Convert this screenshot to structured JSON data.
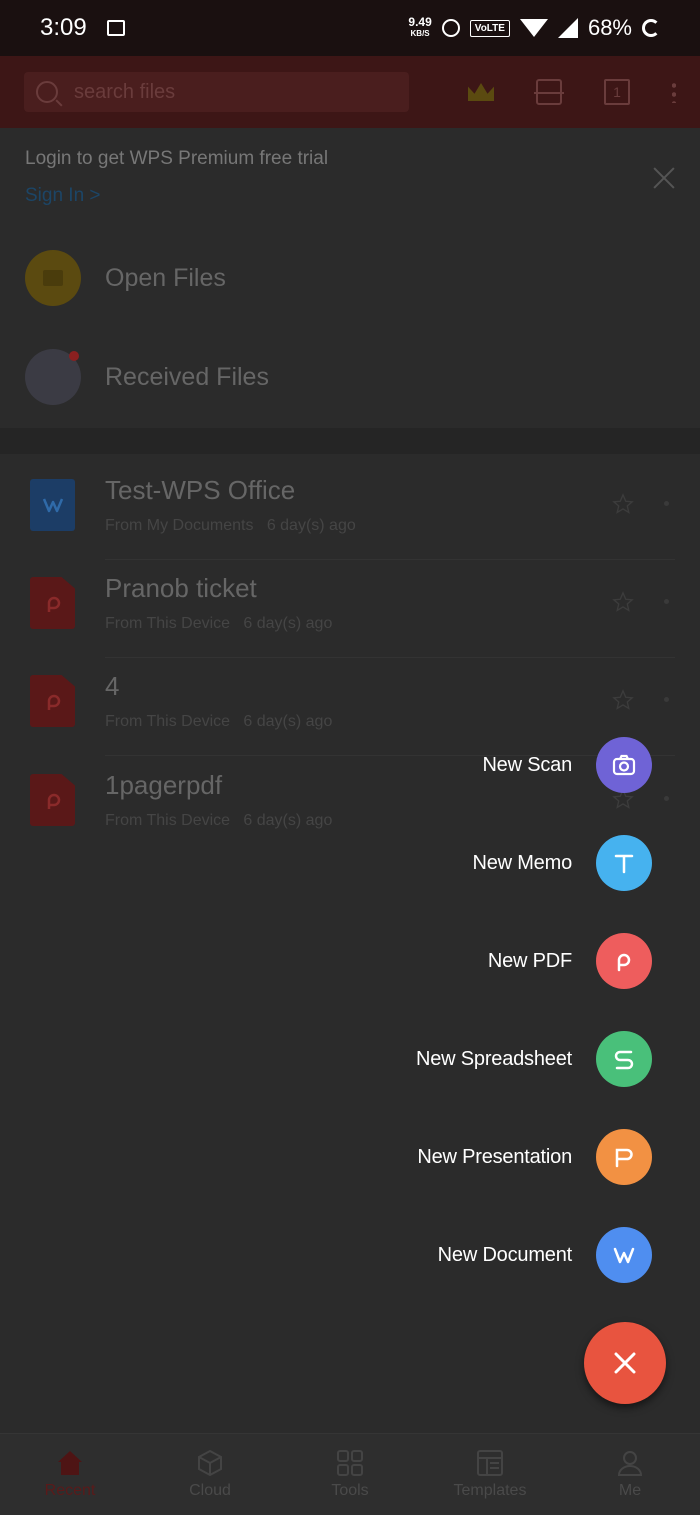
{
  "status_bar": {
    "time": "3:09",
    "net_speed": "9.49",
    "net_unit": "KB/S",
    "volte": "VoLTE",
    "battery": "68%"
  },
  "app_bar": {
    "search_placeholder": "search files",
    "icons": [
      "search-icon",
      "crown-icon",
      "scan-icon",
      "window-count-icon",
      "more-vert-icon"
    ],
    "window_count": "1"
  },
  "banner": {
    "message": "Login to get WPS Premium free trial",
    "sign_in": "Sign In >"
  },
  "quick_access": [
    {
      "label": "Open Files",
      "icon": "folder-icon"
    },
    {
      "label": "Received Files",
      "icon": "received-icon"
    }
  ],
  "recent_files": [
    {
      "name": "Test-WPS Office",
      "source": "From My Documents",
      "age": "6 day(s) ago",
      "type": "writer"
    },
    {
      "name": "Pranob ticket",
      "source": "From This Device",
      "age": "6 day(s) ago",
      "type": "pdf"
    },
    {
      "name": "4",
      "source": "From This Device",
      "age": "6 day(s) ago",
      "type": "pdf"
    },
    {
      "name": "1pagerpdf",
      "source": "From This Device",
      "age": "6 day(s) ago",
      "type": "pdf"
    }
  ],
  "fab_menu": [
    {
      "label": "New Scan",
      "color": "#6f63d6",
      "icon": "camera-icon"
    },
    {
      "label": "New Memo",
      "color": "#46b2ef",
      "icon": "memo-icon"
    },
    {
      "label": "New PDF",
      "color": "#ee5d5d",
      "icon": "pdf-icon"
    },
    {
      "label": "New Spreadsheet",
      "color": "#49c07a",
      "icon": "spreadsheet-icon"
    },
    {
      "label": "New Presentation",
      "color": "#f29143",
      "icon": "presentation-icon"
    },
    {
      "label": "New Document",
      "color": "#4f8ef0",
      "icon": "document-icon"
    }
  ],
  "bottom_nav": [
    {
      "label": "Recent",
      "icon": "home-icon",
      "active": true
    },
    {
      "label": "Cloud",
      "icon": "cloud-icon",
      "active": false
    },
    {
      "label": "Tools",
      "icon": "grid-icon",
      "active": false
    },
    {
      "label": "Templates",
      "icon": "templates-icon",
      "active": false
    },
    {
      "label": "Me",
      "icon": "person-icon",
      "active": false
    }
  ],
  "colors": {
    "fab_close": "#e8543f",
    "overlay_bg": "#2b2b2b",
    "app_bar_dim": "#3d1616"
  }
}
